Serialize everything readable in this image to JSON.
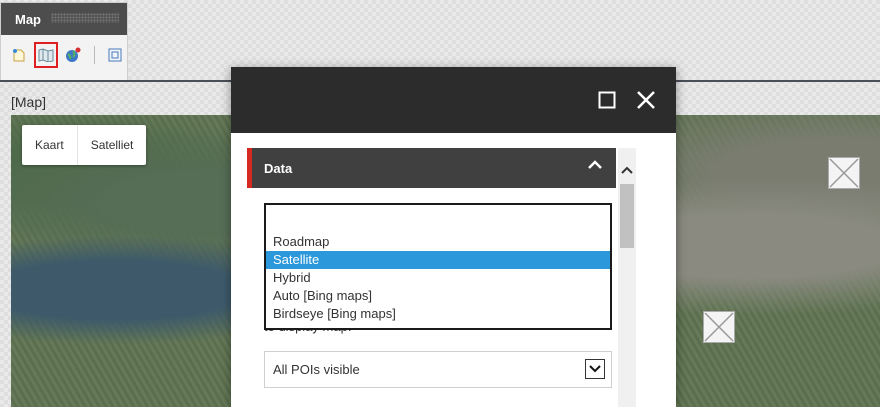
{
  "ribbon": {
    "title": "Map",
    "icons": [
      "new-map-icon",
      "map-icon",
      "globe-icon",
      "fullscreen-icon"
    ]
  },
  "map": {
    "label": "[Map]",
    "type_buttons": [
      "Kaart",
      "Satelliet"
    ]
  },
  "dialog": {
    "section_title": "Data",
    "map_type_options": [
      "Roadmap",
      "Satellite",
      "Hybrid",
      "Auto [Bing maps]",
      "Birdseye [Bing maps]"
    ],
    "selected_option": "Satellite",
    "partial_text": "to display map.",
    "poi_select_value": "All POIs visible"
  },
  "colors": {
    "header_bg": "#2c2c2c",
    "section_bg": "#404040",
    "section_accent": "#d42a20",
    "selection": "#2a98da"
  }
}
